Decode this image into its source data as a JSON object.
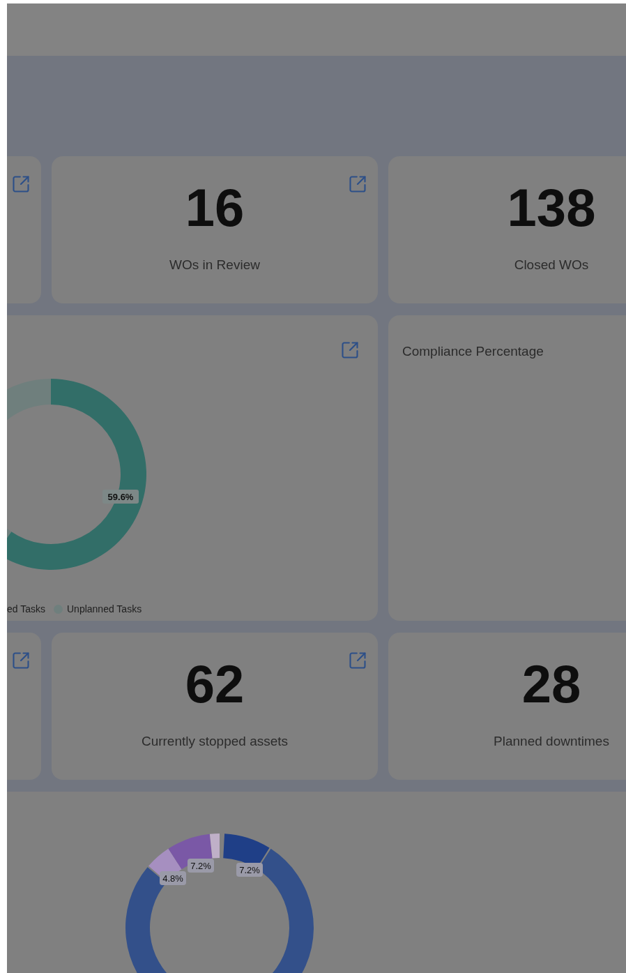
{
  "row_1": [
    {
      "value": "16",
      "label": "WOs in Review"
    },
    {
      "value": "138",
      "label": "Closed WOs"
    }
  ],
  "tasks_chart": {
    "slice_labels": [
      "59.6%"
    ],
    "legend": [
      {
        "label": "ed Tasks"
      },
      {
        "label": "Unplanned Tasks",
        "color": "#6f7f7d"
      }
    ]
  },
  "compliance_card": {
    "title": "Compliance Percentage"
  },
  "row_3": [
    {
      "value": "62",
      "label": "Currently stopped assets"
    },
    {
      "value": "28",
      "label": "Planned downtimes"
    }
  ],
  "bottom_chart": {
    "slice_labels": [
      "7.2%",
      "4.8%",
      "7.2%"
    ]
  }
}
